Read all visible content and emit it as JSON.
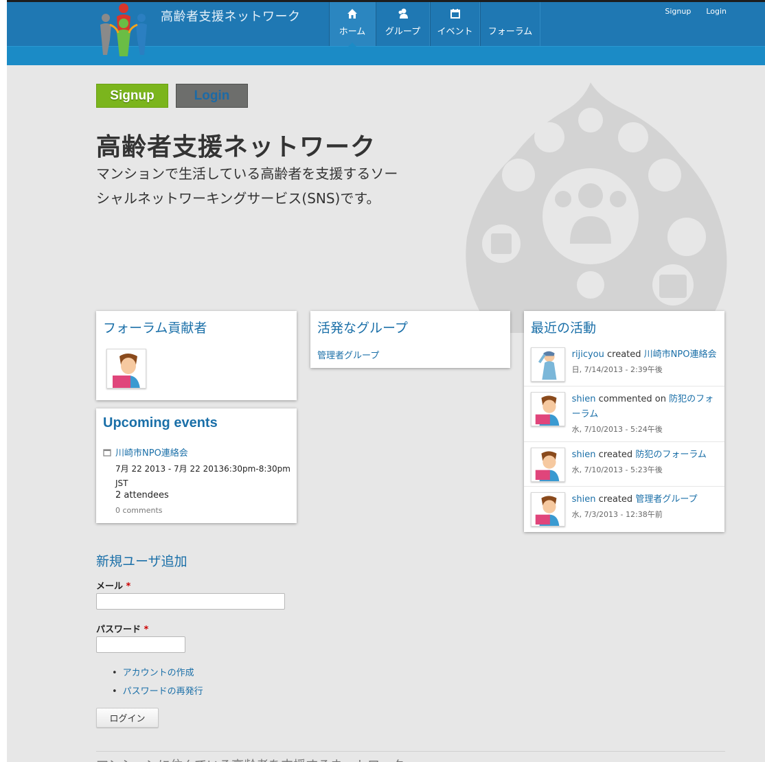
{
  "header": {
    "site_name": "高齢者支援ネットワーク",
    "nav": [
      {
        "label": "ホーム",
        "icon": "home-icon",
        "active": true
      },
      {
        "label": "グループ",
        "icon": "group-icon"
      },
      {
        "label": "イベント",
        "icon": "calendar-icon"
      },
      {
        "label": "フォーラム",
        "icon": ""
      }
    ],
    "top_links": {
      "signup": "Signup",
      "login": "Login"
    },
    "colors": {
      "header": "#1f78b3",
      "subbar": "#1b8bc6"
    }
  },
  "hero": {
    "signup_label": "Signup",
    "login_label": "Login",
    "title": "高齢者支援ネットワーク",
    "subtitle_line1": "マンションで生活している高齢者を支援するソー",
    "subtitle_line2": "シャルネットワーキングサービス(SNS)です。"
  },
  "forum_contributors": {
    "title": "フォーラム貢献者"
  },
  "active_groups": {
    "title": "活発なグループ",
    "items": [
      "管理者グループ"
    ]
  },
  "upcoming_events": {
    "title": "Upcoming events",
    "event": {
      "name": "川崎市NPO連絡会",
      "date_line1": "7月 22 2013 - 7月 22 20136:30pm-8:30pm",
      "date_line2": "JST",
      "attendees": "2 attendees",
      "comments": "0 comments"
    }
  },
  "recent_activity": {
    "title": "最近の活動",
    "items": [
      {
        "user": "rijicyou",
        "verb": " created ",
        "target": "川崎市NPO連絡会",
        "time": "日, 7/14/2013 - 2:39午後"
      },
      {
        "user": "shien",
        "verb": " commented on ",
        "target": "防犯のフォーラム",
        "time": "水, 7/10/2013 - 5:24午後"
      },
      {
        "user": "shien",
        "verb": " created ",
        "target": "防犯のフォーラム",
        "time": "水, 7/10/2013 - 5:23午後"
      },
      {
        "user": "shien",
        "verb": " created ",
        "target": "管理者グループ",
        "time": "水, 7/3/2013 - 12:38午前"
      }
    ]
  },
  "login_form": {
    "title": "新規ユーザ追加",
    "email_label": "メール",
    "password_label": "パスワード",
    "required_mark": "*",
    "links": [
      "アカウントの作成",
      "パスワードの再発行"
    ],
    "submit_label": "ログイン"
  },
  "footer": {
    "text": "マンションに住んでいる高齢者を支援するネットワーク"
  }
}
